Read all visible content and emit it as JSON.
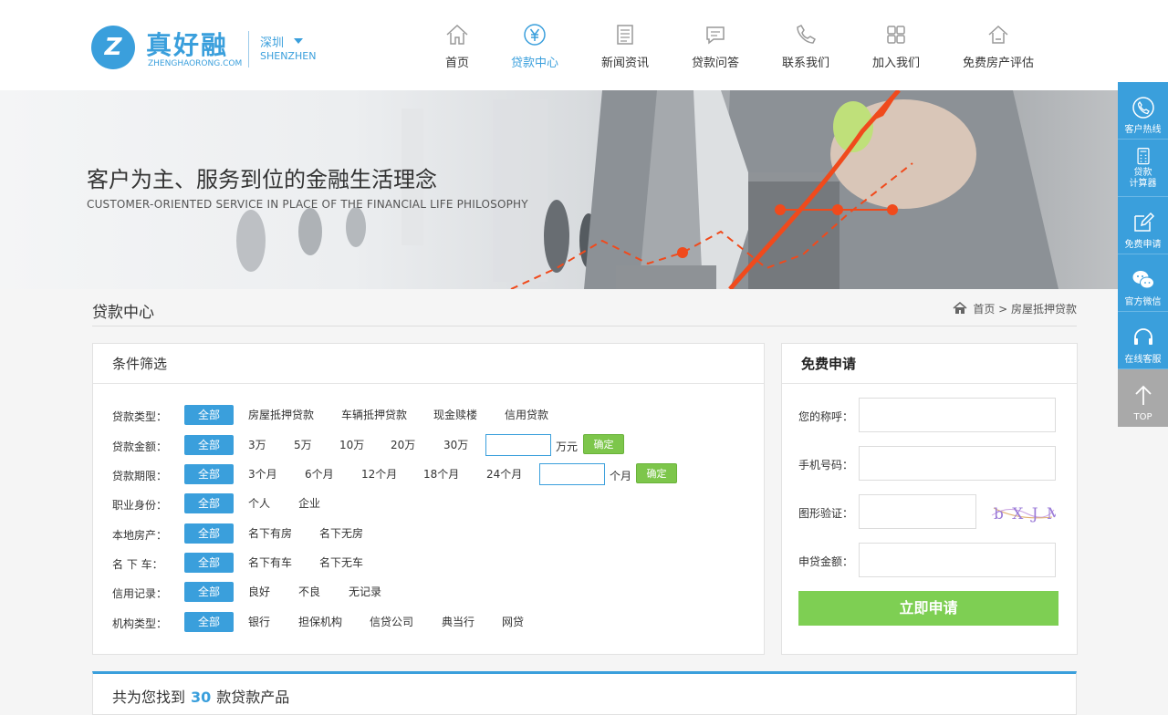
{
  "brand": {
    "logo_mark": "Z",
    "name": "真好融",
    "domain": "ZHENGHAORONG.COM",
    "city_cn": "深圳",
    "city_en": "SHENZHEN"
  },
  "nav": [
    {
      "label": "首页",
      "icon": "home-icon"
    },
    {
      "label": "贷款中心",
      "icon": "yen-icon",
      "active": true
    },
    {
      "label": "新闻资讯",
      "icon": "document-icon"
    },
    {
      "label": "贷款问答",
      "icon": "chat-icon"
    },
    {
      "label": "联系我们",
      "icon": "phone-icon"
    },
    {
      "label": "加入我们",
      "icon": "grid-icon"
    },
    {
      "label": "免费房产评估",
      "icon": "house-icon"
    }
  ],
  "banner": {
    "title": "客户为主、服务到位的金融生活理念",
    "subtitle": "CUSTOMER-ORIENTED SERVICE IN PLACE OF THE FINANCIAL LIFE PHILOSOPHY"
  },
  "page": {
    "title": "贷款中心",
    "breadcrumb": "首页 > 房屋抵押贷款"
  },
  "filter": {
    "title": "条件筛选",
    "rows": [
      {
        "label": "贷款类型：",
        "all": "全部",
        "options": [
          "房屋抵押贷款",
          "车辆抵押贷款",
          "现金赎楼",
          "信用贷款"
        ]
      },
      {
        "label": "贷款金额：",
        "all": "全部",
        "options": [
          "3万",
          "5万",
          "10万",
          "20万",
          "30万"
        ],
        "unit": "万元",
        "confirm": "确定"
      },
      {
        "label": "贷款期限：",
        "all": "全部",
        "options": [
          "3个月",
          "6个月",
          "12个月",
          "18个月",
          "24个月"
        ],
        "unit": "个月",
        "confirm": "确定"
      },
      {
        "label": "职业身份：",
        "all": "全部",
        "options": [
          "个人",
          "企业"
        ]
      },
      {
        "label": "本地房产：",
        "all": "全部",
        "options": [
          "名下有房",
          "名下无房"
        ]
      },
      {
        "label": "名 下 车：",
        "all": "全部",
        "options": [
          "名下有车",
          "名下无车"
        ]
      },
      {
        "label": "信用记录：",
        "all": "全部",
        "options": [
          "良好",
          "不良",
          "无记录"
        ]
      },
      {
        "label": "机构类型：",
        "all": "全部",
        "options": [
          "银行",
          "担保机构",
          "信贷公司",
          "典当行",
          "网贷"
        ]
      }
    ]
  },
  "apply": {
    "title": "免费申请",
    "name_label": "您的称呼：",
    "phone_label": "手机号码：",
    "captcha_label": "图形验证：",
    "captcha_text": "b X J M",
    "amount_label": "申贷金额：",
    "submit": "立即申请"
  },
  "result": {
    "prefix": "共为您找到",
    "count": "30",
    "suffix": "款贷款产品"
  },
  "sidebar": [
    {
      "label": "客户热线",
      "icon": "phone-icon"
    },
    {
      "label": "贷款\n计算器",
      "icon": "calculator-icon"
    },
    {
      "label": "免费申请",
      "icon": "edit-icon"
    },
    {
      "label": "官方微信",
      "icon": "wechat-icon"
    },
    {
      "label": "在线客服",
      "icon": "headset-icon"
    },
    {
      "label": "TOP",
      "icon": "arrow-up-icon"
    }
  ],
  "colors": {
    "primary": "#3a9fdc",
    "green": "#7ecf53",
    "banner_accent": "#f04a1c"
  }
}
